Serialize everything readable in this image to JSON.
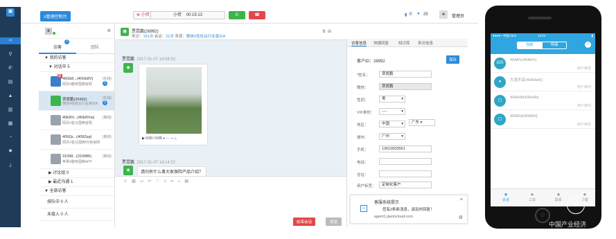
{
  "topbar": {
    "console_btn": "≡管理控制台",
    "call_status": "小伏",
    "call_name": "小伏",
    "call_time": "00:15:13",
    "doc_count": "0",
    "chat_count": "25",
    "user": "管理员"
  },
  "left": {
    "tabs": [
      "访客",
      "团队"
    ],
    "tab_badge": "2",
    "my_visitors": "▼ 我的访客",
    "talking": "▼ 对话中 5",
    "items": [
      {
        "t1": "40Gk8...(40Gk8V)",
        "t2": "网页#趣味围棋官网",
        "st": "(在线)",
        "badge": "1",
        "color": "#3d7ecb",
        "tag": "新"
      },
      {
        "t1": "贾昆鹏(26992)",
        "t2": "微信#佳佳云行业演示A",
        "st": "(在线)",
        "badge": "1",
        "color": "#3fb34f",
        "tag": ""
      },
      {
        "t1": "40ERV...(40ERVw)",
        "t2": "网页#金马围棋官网",
        "st": "(离线)",
        "badge": "",
        "color": "#9aa3ab",
        "tag": ""
      },
      {
        "t1": "409Zp...(409Zpp)",
        "t2": "网页#金马围棋H5官官网",
        "st": "(离线)",
        "badge": "",
        "color": "#9aa3ab",
        "tag": ""
      },
      {
        "t1": "31098...(310986)",
        "t2": "苹果#趣味围棋APP",
        "st": "(离线)",
        "badge": "",
        "color": "#9aa3ab",
        "tag": ""
      }
    ],
    "group_ended": "▶ 讨论组 0",
    "recent": "▶ 最近沟通 1",
    "all_visitors": "▼ 全部访客",
    "queue": "排队中 0 人",
    "unassigned": "未接入 0 人"
  },
  "chat": {
    "name": "贾昆鹏(26992)",
    "meta_prefix": "来访：",
    "meta_visits": "161次",
    "meta_sessions_label": "会话：",
    "meta_sessions": "21次",
    "meta_source_label": "来源：",
    "meta_source": "微信#佳佳云行业演示A",
    "msg1_name": "贾昆鹏",
    "msg1_time": "2017-01-07 14:08:32",
    "video_time": "▶ 0:00 / 0:05",
    "msg2_name": "贾昆鹏",
    "msg2_time": "2017-01-07 14:14:22",
    "msg2_text": "请问有什么事大家保险产品介绍？",
    "end_btn": "结束会话",
    "send_btn": "发送"
  },
  "right": {
    "tabs": [
      "访客信息",
      "快捷回复",
      "知识库",
      "来访信息"
    ],
    "customer_id": "客户ID：26992",
    "save": "保存",
    "fields": [
      {
        "label": "*姓名：",
        "value": "贾昆鹏"
      },
      {
        "label": "微信：",
        "value": "贾昆鹏"
      },
      {
        "label": "性别：",
        "value": "男"
      },
      {
        "label": "VIP身份：",
        "value": "----"
      },
      {
        "label": "地区：",
        "value": "中国"
      },
      {
        "label": "城市：",
        "value": "广州"
      },
      {
        "label": "手机：",
        "value": "13610003561"
      },
      {
        "label": "电话：",
        "value": ""
      },
      {
        "label": "住址：",
        "value": ""
      }
    ],
    "region2": "广东",
    "user_tag_label": "用户标签：",
    "user_tag": "定制化客户",
    "notify_title": "客服系统提示",
    "notify_text": "您有2条新消息，请及时回复！",
    "notify_sub": "agent1.jiaxincloud.com"
  },
  "phone": {
    "status_left": "●●●●○ 中国 0K/s",
    "status_time": "13:02",
    "tab_chat": "当前",
    "tab_wait": "待接",
    "items": [
      {
        "name": "40AiPz(40AiPz)",
        "status": "用户离线",
        "icon": "iOS"
      },
      {
        "name": "大发乐享(40AHwK)",
        "status": "用户离线",
        "icon": "●"
      },
      {
        "name": "40Ae9b(40Ae9b)",
        "status": "用户离线",
        "icon": "▢"
      },
      {
        "name": "40AiRd(40AiRd)",
        "status": "用户离线",
        "icon": "▢"
      }
    ],
    "nav": [
      "会话",
      "工单",
      "联系",
      "设置"
    ],
    "watermark": "中国产业经济"
  }
}
